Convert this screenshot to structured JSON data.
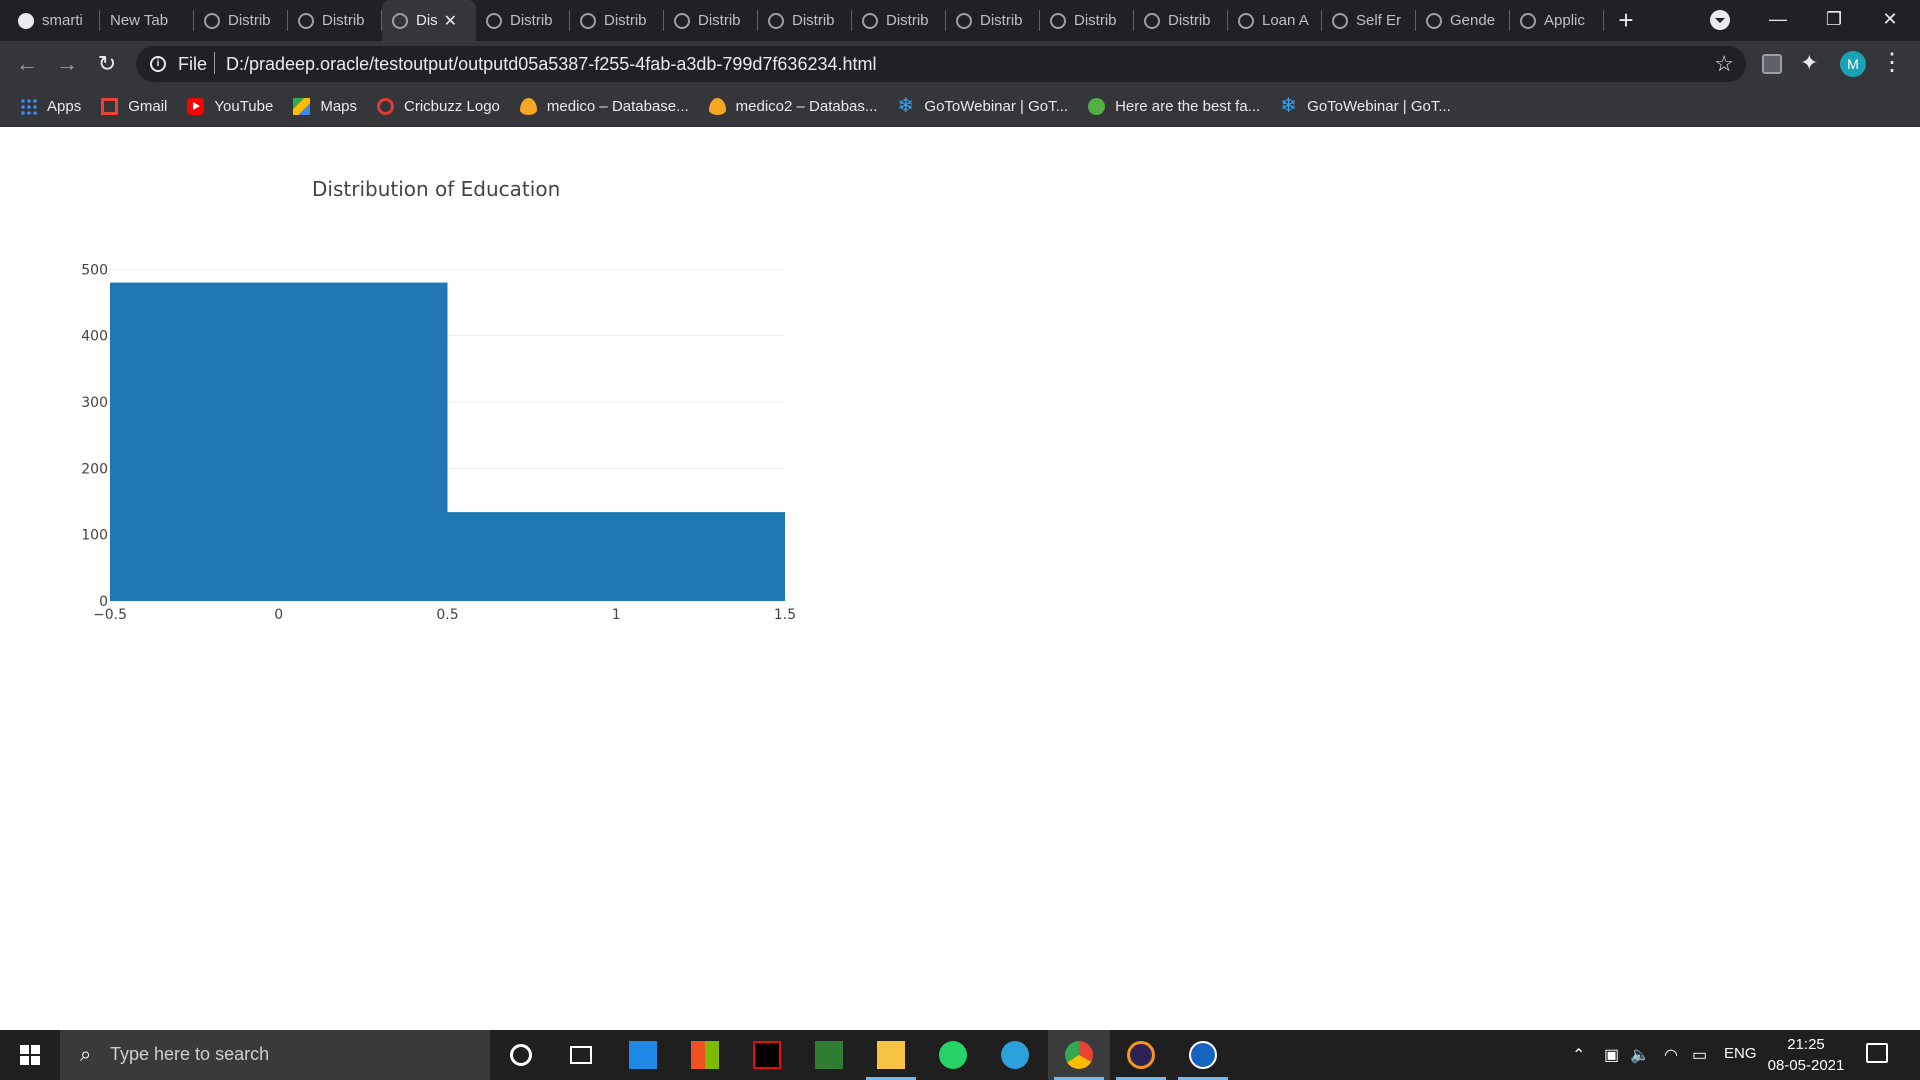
{
  "browser": {
    "tabs": [
      {
        "label": "smarti",
        "icon": "github-icon",
        "active": false
      },
      {
        "label": "New Tab",
        "icon": "",
        "active": false
      },
      {
        "label": "Distrib",
        "icon": "globe-icon",
        "active": false
      },
      {
        "label": "Distrib",
        "icon": "globe-icon",
        "active": false
      },
      {
        "label": "Dis",
        "icon": "globe-icon",
        "active": true
      },
      {
        "label": "Distrib",
        "icon": "globe-icon",
        "active": false
      },
      {
        "label": "Distrib",
        "icon": "globe-icon",
        "active": false
      },
      {
        "label": "Distrib",
        "icon": "globe-icon",
        "active": false
      },
      {
        "label": "Distrib",
        "icon": "globe-icon",
        "active": false
      },
      {
        "label": "Distrib",
        "icon": "globe-icon",
        "active": false
      },
      {
        "label": "Distrib",
        "icon": "globe-icon",
        "active": false
      },
      {
        "label": "Distrib",
        "icon": "globe-icon",
        "active": false
      },
      {
        "label": "Distrib",
        "icon": "globe-icon",
        "active": false
      },
      {
        "label": "Loan A",
        "icon": "globe-icon",
        "active": false
      },
      {
        "label": "Self Er",
        "icon": "globe-icon",
        "active": false
      },
      {
        "label": "Gende",
        "icon": "globe-icon",
        "active": false
      },
      {
        "label": "Applic",
        "icon": "globe-icon",
        "active": false
      }
    ],
    "new_tab_label": "+",
    "close_tab_label": "✕",
    "window_controls": {
      "minimize": "—",
      "restore": "❐",
      "close": "✕"
    },
    "address": {
      "scheme_label": "File",
      "url": "D:/pradeep.oracle/testoutput/outputd05a5387-f255-4fab-a3db-799d7f636234.html"
    },
    "profile_initial": "M",
    "bookmarks": [
      {
        "label": "Apps",
        "icon": "apps-grid-icon"
      },
      {
        "label": "Gmail",
        "icon": "gmail-icon"
      },
      {
        "label": "YouTube",
        "icon": "youtube-icon"
      },
      {
        "label": "Maps",
        "icon": "maps-icon"
      },
      {
        "label": "Cricbuzz Logo",
        "icon": "cricbuzz-icon"
      },
      {
        "label": "medico – Database...",
        "icon": "firebase-icon"
      },
      {
        "label": "medico2 – Databas...",
        "icon": "firebase-icon"
      },
      {
        "label": "GoToWebinar | GoT...",
        "icon": "gotowebinar-icon"
      },
      {
        "label": "Here are the best fa...",
        "icon": "green-circle-icon"
      },
      {
        "label": "GoToWebinar | GoT...",
        "icon": "gotowebinar-icon"
      }
    ]
  },
  "chart_data": {
    "type": "bar",
    "title": "Distribution of  Education",
    "bins": [
      {
        "x0": -0.5,
        "x1": 0.5,
        "value": 480
      },
      {
        "x0": 0.5,
        "x1": 1.5,
        "value": 134
      }
    ],
    "x_ticks": [
      -0.5,
      0,
      0.5,
      1,
      1.5
    ],
    "x_tick_labels": [
      "−0.5",
      "0",
      "0.5",
      "1",
      "1.5"
    ],
    "y_ticks": [
      0,
      100,
      200,
      300,
      400,
      500
    ],
    "y_tick_labels": [
      "0",
      "100",
      "200",
      "300",
      "400",
      "500"
    ],
    "xlim": [
      -0.5,
      1.5
    ],
    "ylim": [
      0,
      505
    ],
    "grid": true,
    "bar_color": "#1f77b4"
  },
  "taskbar": {
    "search_placeholder": "Type here to search",
    "apps": [
      {
        "name": "cortana-icon",
        "running": false,
        "active": false
      },
      {
        "name": "task-view-icon",
        "running": false,
        "active": false
      },
      {
        "name": "mail-icon",
        "running": false,
        "active": false
      },
      {
        "name": "store-icon",
        "running": false,
        "active": false
      },
      {
        "name": "netflix-icon",
        "running": false,
        "active": false
      },
      {
        "name": "bible-app-icon",
        "running": false,
        "active": false
      },
      {
        "name": "file-explorer-icon",
        "running": true,
        "active": false
      },
      {
        "name": "whatsapp-icon",
        "running": false,
        "active": false
      },
      {
        "name": "telegram-icon",
        "running": false,
        "active": false
      },
      {
        "name": "chrome-icon",
        "running": true,
        "active": true
      },
      {
        "name": "eclipse-icon",
        "running": true,
        "active": false
      },
      {
        "name": "compass-app-icon",
        "running": true,
        "active": false
      }
    ],
    "language": "ENG",
    "time": "21:25",
    "date": "08-05-2021"
  }
}
